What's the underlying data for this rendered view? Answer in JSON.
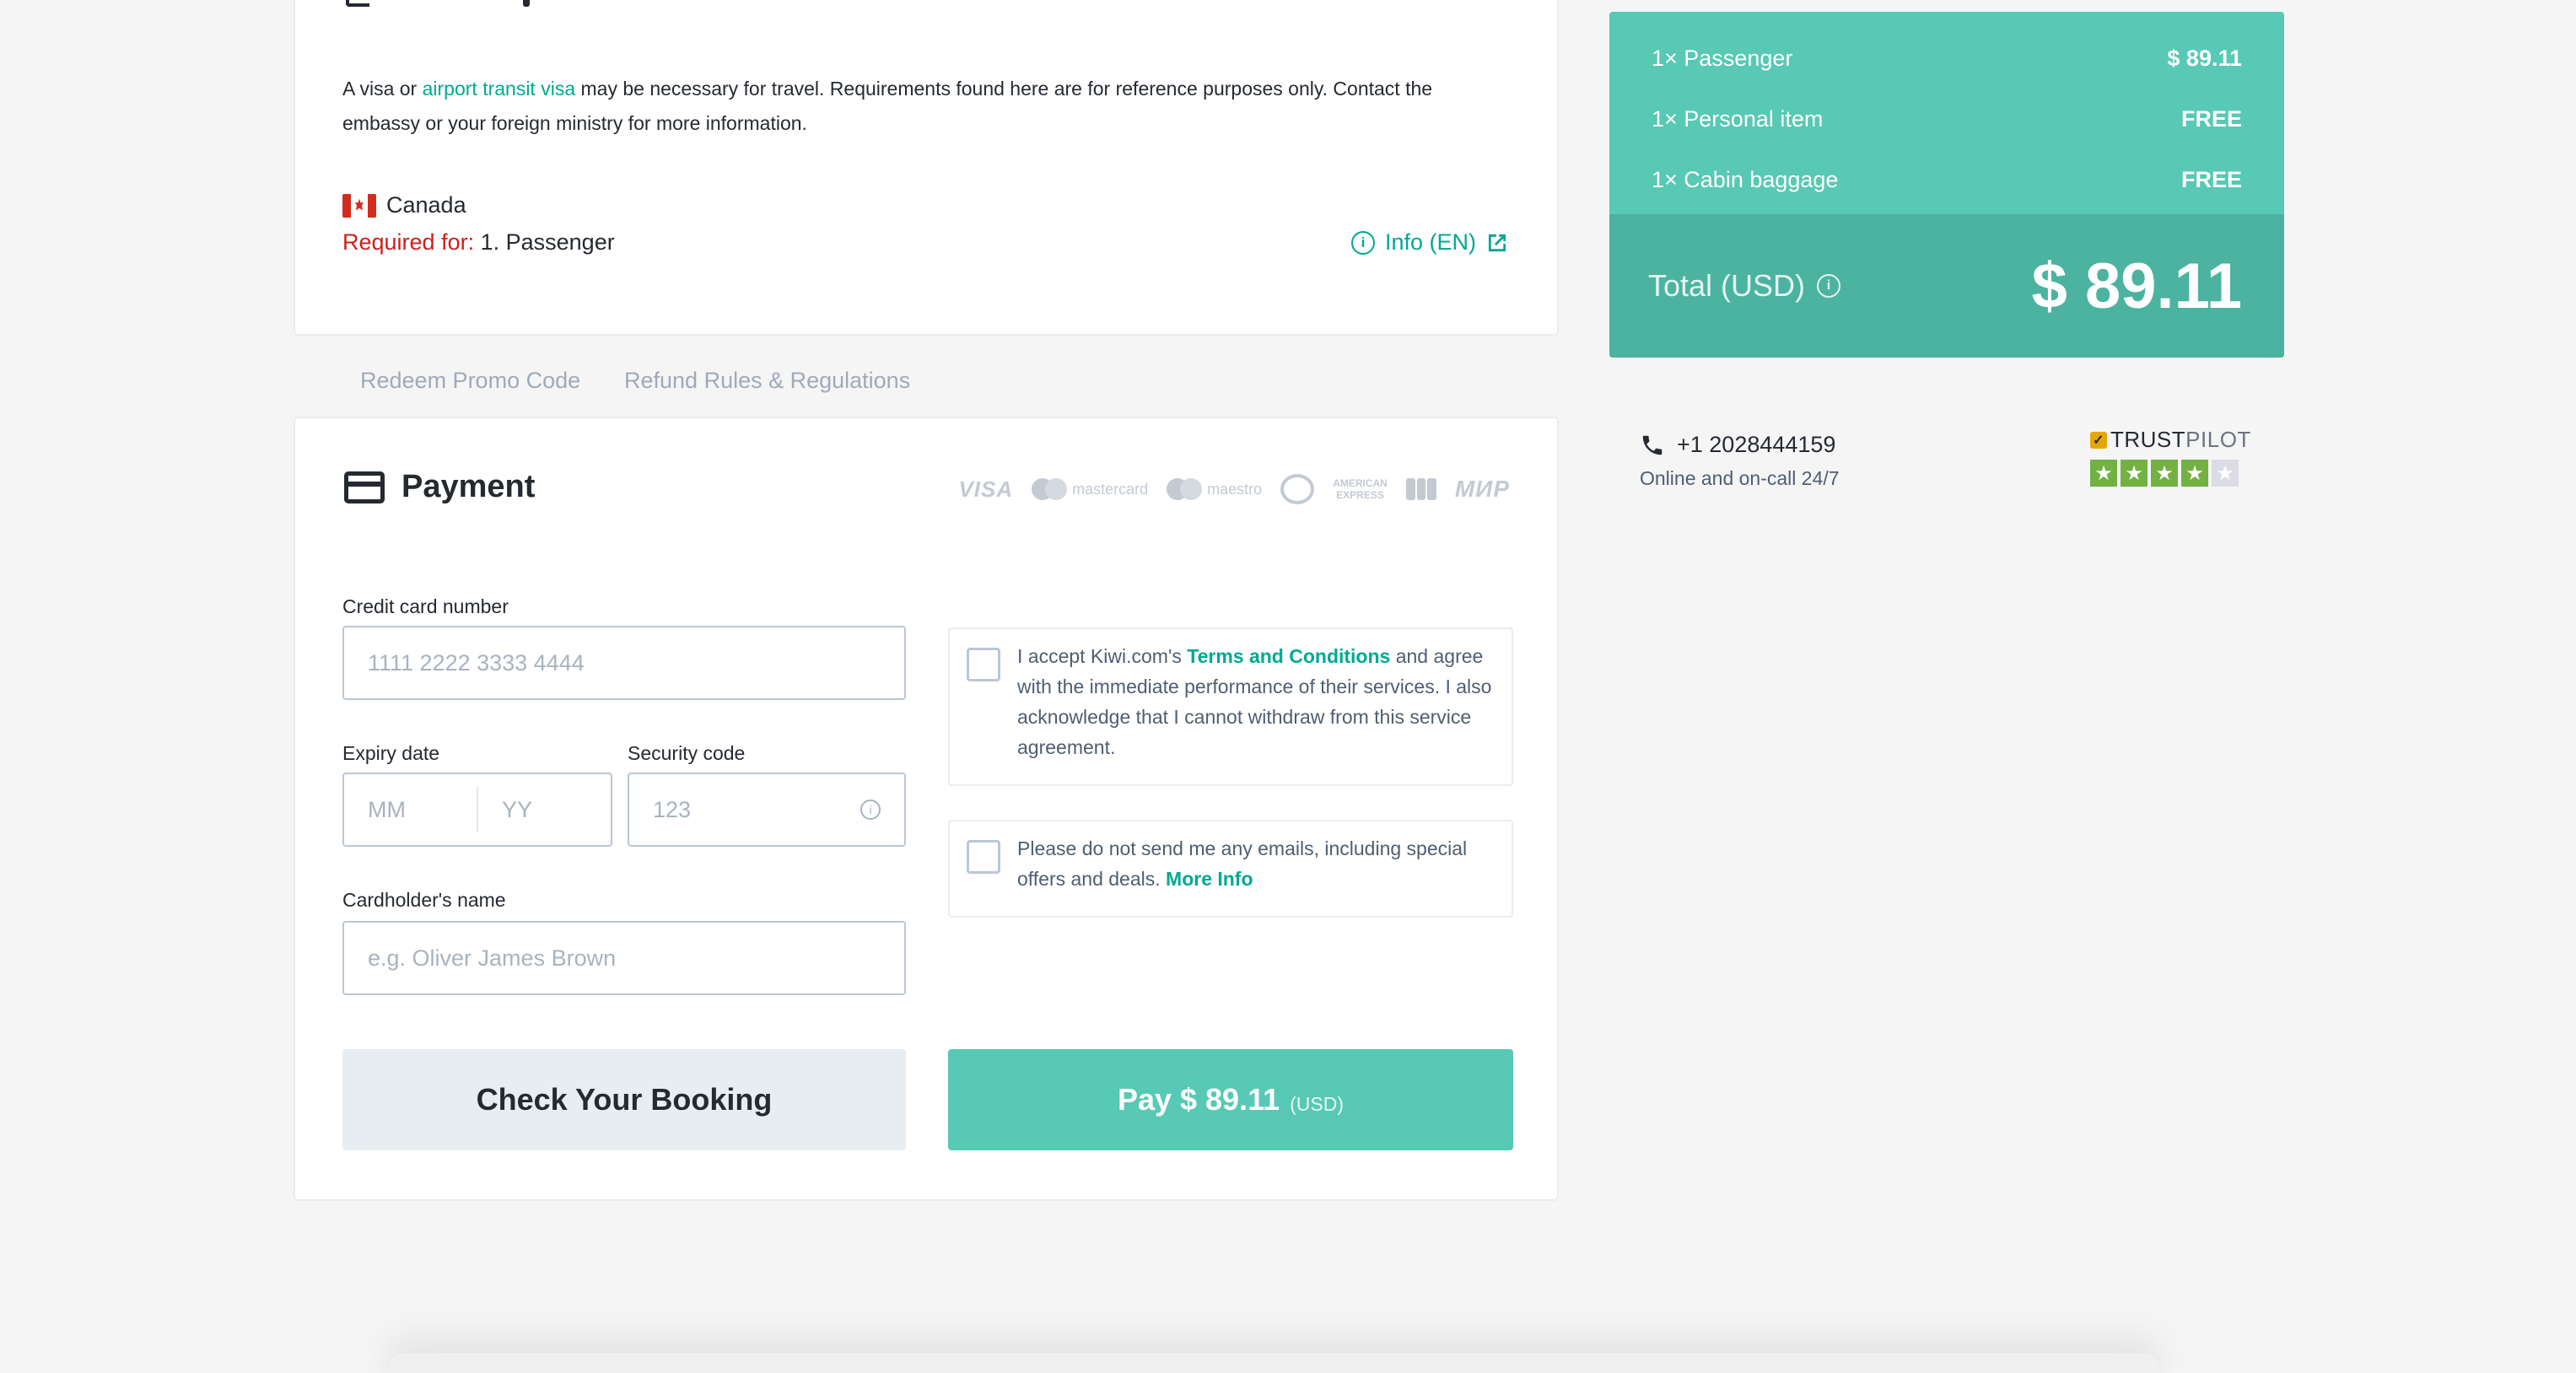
{
  "visa": {
    "text_before": "A visa or ",
    "link": "airport transit visa",
    "text_line1_after": " may be necessary for travel. Requirements found here are for reference purposes only. Contact the",
    "text_line2": "embassy or your foreign ministry for more information.",
    "country": "Canada",
    "required_label": "Required for:",
    "required_value": " 1. Passenger",
    "info_link": "Info (EN)"
  },
  "tabs": [
    "Redeem Promo Code",
    "Refund Rules & Regulations"
  ],
  "payment": {
    "title": "Payment",
    "brands": {
      "visa": "VISA",
      "mastercard": "mastercard",
      "maestro": "maestro",
      "amex_line1": "AMERICAN",
      "amex_line2": "EXPRESS",
      "mir": "МИР"
    },
    "card_number_label": "Credit card number",
    "card_number_placeholder": "1111 2222 3333 4444",
    "expiry_label": "Expiry date",
    "expiry_mm": "MM",
    "expiry_yy": "YY",
    "security_label": "Security code",
    "security_placeholder": "123",
    "name_label": "Cardholder's name",
    "name_placeholder": "e.g. Oliver James Brown",
    "terms_before": "I accept Kiwi.com's ",
    "terms_link": "Terms and Conditions",
    "terms_after": " and agree with the immediate performance of their services. I also acknowledge that I cannot withdraw from this service agreement.",
    "emails_text": "Please do not send me any emails, including special offers and deals. ",
    "emails_link": "More Info",
    "check_button": "Check Your Booking",
    "pay_button": "Pay $ 89.11",
    "pay_currency": "(USD)"
  },
  "summary": {
    "rows": [
      {
        "label": "1× Passenger",
        "value": "$ 89.11"
      },
      {
        "label": "1× Personal item",
        "value": "FREE"
      },
      {
        "label": "1× Cabin baggage",
        "value": "FREE"
      }
    ],
    "total_label": "Total (USD)",
    "total_value": "$ 89.11"
  },
  "support": {
    "phone": "+1 2028444159",
    "availability": "Online and on-call 24/7"
  },
  "trustpilot": {
    "brand_bold": "TRUST",
    "brand_light": "PILOT",
    "rating": 4,
    "max_rating": 5
  },
  "colors": {
    "accent": "#00a991",
    "summary_bg": "#57c9b4",
    "summary_total_bg": "#4bb39f",
    "required": "#d21c1c"
  }
}
